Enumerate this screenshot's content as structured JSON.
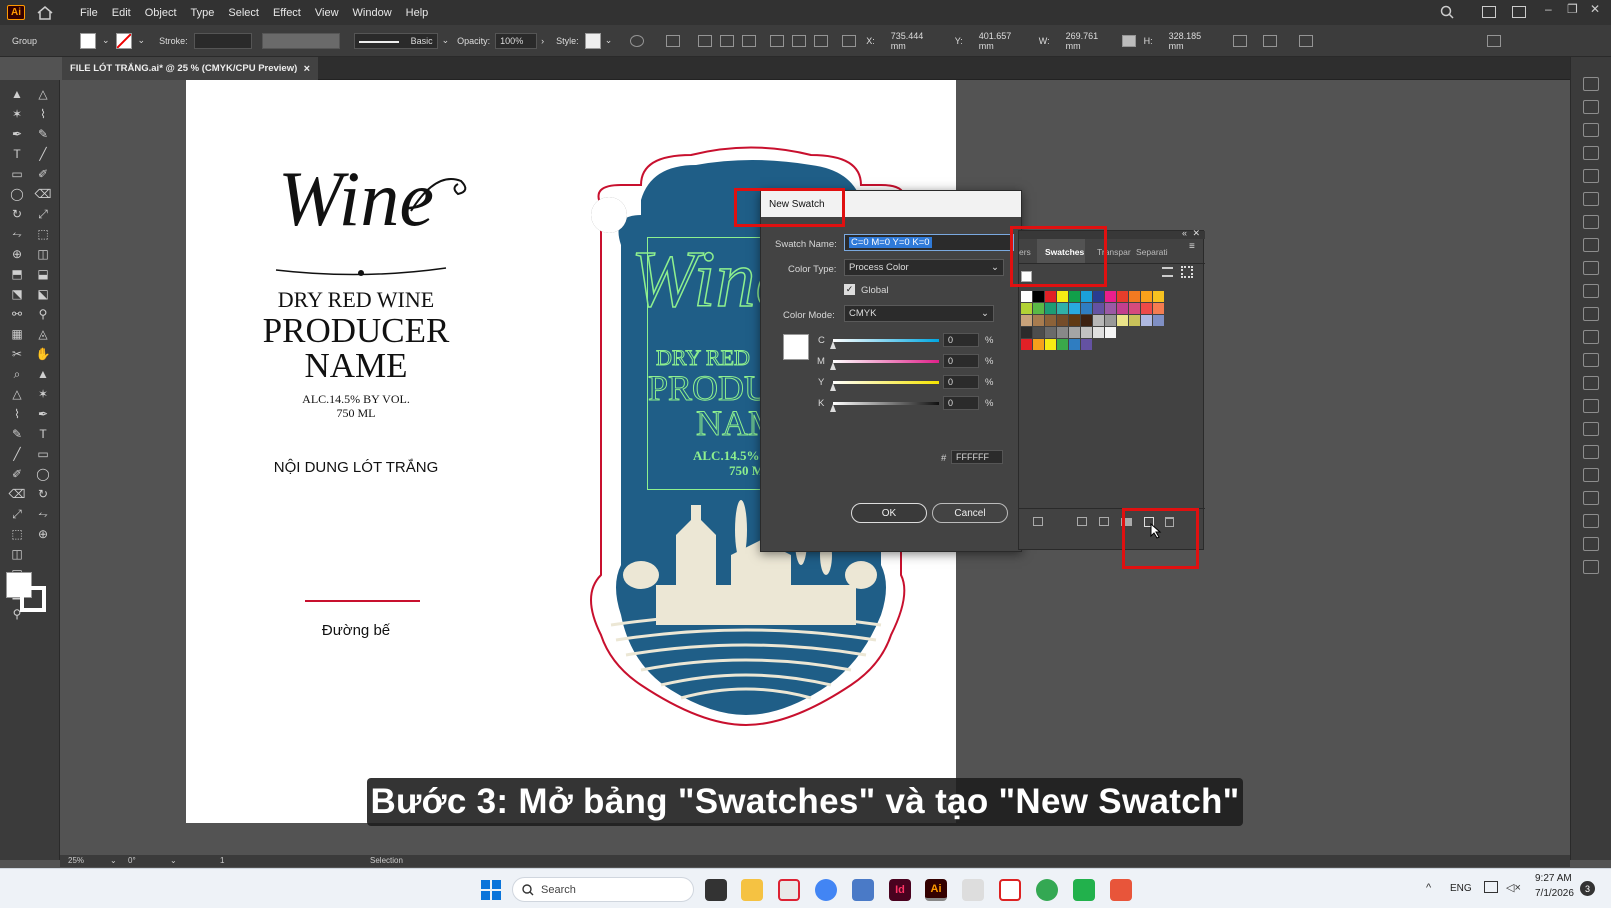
{
  "menubar": {
    "app_badge": "Ai",
    "items": [
      "File",
      "Edit",
      "Object",
      "Type",
      "Select",
      "Effect",
      "View",
      "Window",
      "Help"
    ]
  },
  "control": {
    "selection": "Group",
    "stroke_label": "Stroke:",
    "brush": "Basic",
    "opacity_label": "Opacity:",
    "opacity_value": "100%",
    "style_label": "Style:",
    "x_label": "X:",
    "x_value": "735.444 mm",
    "y_label": "Y:",
    "y_value": "401.657 mm",
    "w_label": "W:",
    "w_value": "269.761 mm",
    "h_label": "H:",
    "h_value": "328.185 mm"
  },
  "document": {
    "tab_title": "FILE LÓT TRẮNG.ai* @ 25 % (CMYK/CPU Preview)",
    "tab_close": "×"
  },
  "artwork": {
    "wine": "Wine",
    "dry_red": "DRY RED WINE",
    "producer": "PRODUCER",
    "name": "NAME",
    "alc": "ALC.14.5% BY VOL.",
    "ml": "750 ML",
    "white_content": "NỘI DUNG LÓT TRẮNG",
    "base_line": "Đường bế",
    "blue_dry": "DRY RED",
    "blue_produ": "PRODU",
    "blue_nam": "NAM",
    "blue_alc": "ALC.14.5%",
    "blue_ml": "750 M"
  },
  "dialog": {
    "title": "New Swatch",
    "swatch_name_label": "Swatch Name:",
    "swatch_name_value": "C=0 M=0 Y=0 K=0",
    "color_type_label": "Color Type:",
    "color_type_value": "Process Color",
    "global_label": "Global",
    "color_mode_label": "Color Mode:",
    "color_mode_value": "CMYK",
    "channels": [
      {
        "label": "C",
        "value": "0",
        "unit": "%"
      },
      {
        "label": "M",
        "value": "0",
        "unit": "%"
      },
      {
        "label": "Y",
        "value": "0",
        "unit": "%"
      },
      {
        "label": "K",
        "value": "0",
        "unit": "%"
      }
    ],
    "hex_label": "#",
    "hex_value": "FFFFFF",
    "ok_label": "OK",
    "cancel_label": "Cancel"
  },
  "swatches_panel": {
    "tab_prev": "ers",
    "tab_active": "Swatches",
    "tab_transp": "Transpar",
    "tab_separ": "Separati"
  },
  "status": {
    "zoom": "25%",
    "rotation": "0°",
    "artboard": "1",
    "tool": "Selection"
  },
  "caption": "Bước 3: Mở bảng \"Swatches\" và tạo \"New Swatch\"",
  "taskbar": {
    "search_placeholder": "Search",
    "lang": "ENG",
    "time": "9:27 AM",
    "date": "7/1/2026",
    "notif": "3"
  },
  "colors": {
    "label_blue": "#1f5e87",
    "highlight_red": "#e01010",
    "bottle_red": "#c8102e"
  }
}
